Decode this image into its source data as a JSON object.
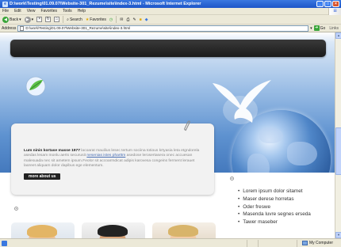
{
  "window": {
    "title": "D:\\work\\Testing\\01.09.07\\Website-301_Rezume\\site\\index-3.html - Microsoft Internet Explorer",
    "icon": "ie-icon",
    "controls": {
      "minimize": "_",
      "maximize": "□",
      "close": "×"
    }
  },
  "menubar": {
    "items": [
      "File",
      "Edit",
      "View",
      "Favorites",
      "Tools",
      "Help"
    ]
  },
  "toolbar": {
    "back_label": "Back",
    "search_label": "Search",
    "favorites_label": "Favorites"
  },
  "addressbar": {
    "label": "Address",
    "value": "D:\\work\\Testing\\01.09.07\\Website-301_Rezume\\site\\index-3.html",
    "go_label": "Go",
    "links_label": "Links"
  },
  "page": {
    "card": {
      "lead": "Lum ninin kortase masse 1977",
      "text_before_link": " lacoarat mauilius lesec tertum sociina totious krtyasia leta etgndorela asedas lesam monlu aerts securusit ",
      "link": "nesenias istes pharttm",
      "text_after_link": " asedose lerosertasera onec accuesan malesuada nec sit ametem ipsum.Feolor sit accoarmdicat adipis karovesa congeins ferment lerauet laoreet aliquam dolor dapibus ege elementum.",
      "button": "more about us"
    },
    "list": [
      "Lorem ipsum dolor sitamet",
      "Maser derese horretas",
      "Oder freswe",
      "Masenda luvre segnes erseda",
      "Tawer maseber"
    ]
  },
  "statusbar": {
    "zone": "My Computer"
  },
  "colors": {
    "titlebar": "#1d55c8",
    "chrome": "#ece9d8",
    "navbar": "#222222",
    "sky_top": "#dbe8f7",
    "sky_bottom": "#2e5d9e",
    "link": "#4a6fb4",
    "logo_green": "#5dc24a"
  }
}
